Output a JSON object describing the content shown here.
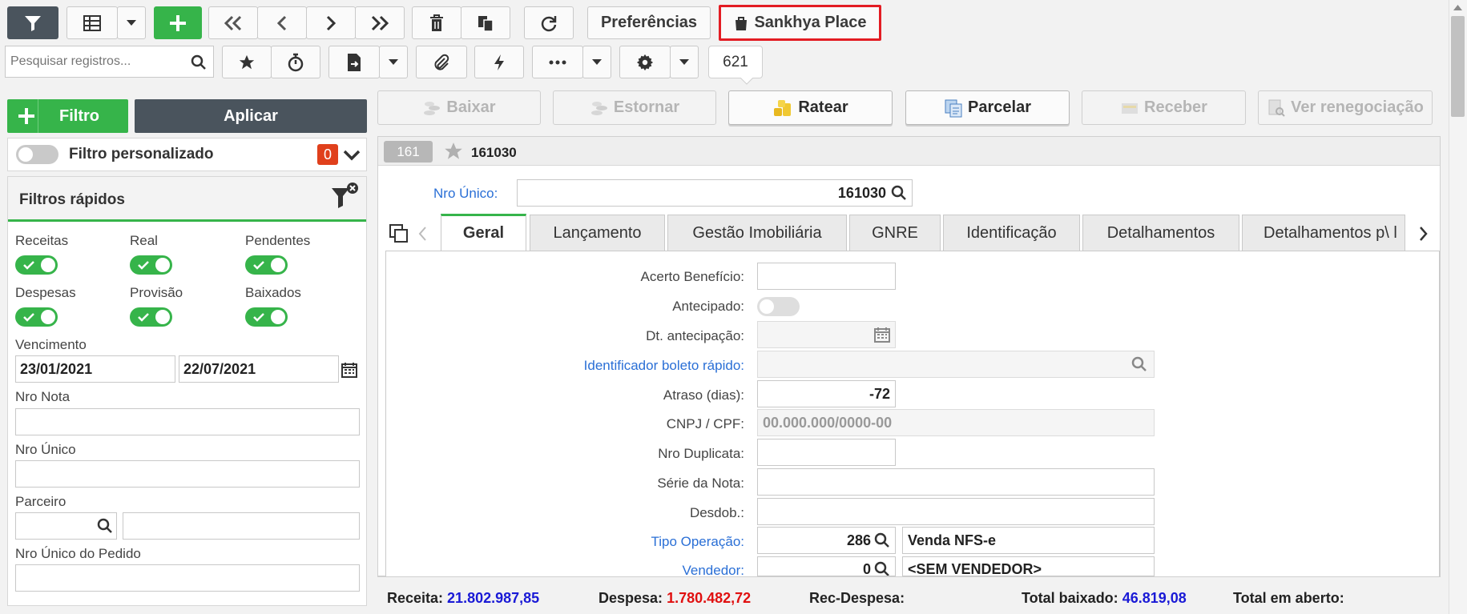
{
  "toolbar": {
    "preferences_label": "Preferências",
    "sankhya_place_label": "Sankhya Place",
    "search_placeholder": "Pesquisar registros...",
    "counter": "621"
  },
  "actions": {
    "baixar": "Baixar",
    "estornar": "Estornar",
    "ratear": "Ratear",
    "parcelar": "Parcelar",
    "receber": "Receber",
    "ver_renegociacao": "Ver renegociação"
  },
  "left": {
    "filter_btn": "Filtro",
    "apply_btn": "Aplicar",
    "custom_filter_label": "Filtro personalizado",
    "custom_filter_count": "0",
    "quick_filters_title": "Filtros rápidos",
    "toggles": [
      {
        "label": "Receitas"
      },
      {
        "label": "Real"
      },
      {
        "label": "Pendentes"
      },
      {
        "label": "Despesas"
      },
      {
        "label": "Provisão"
      },
      {
        "label": "Baixados"
      }
    ],
    "vencimento_label": "Vencimento",
    "date_from": "23/01/2021",
    "date_to": "22/07/2021",
    "nro_nota_label": "Nro Nota",
    "nro_unico_label": "Nro Único",
    "parceiro_label": "Parceiro",
    "nro_unico_pedido_label": "Nro Único do Pedido"
  },
  "record": {
    "badge": "161",
    "id": "161030",
    "nro_unico_label": "Nro Único:",
    "nro_unico_value": "161030"
  },
  "tabs": [
    "Geral",
    "Lançamento",
    "Gestão Imobiliária",
    "GNRE",
    "Identificação",
    "Detalhamentos",
    "Detalhamentos p\\ l"
  ],
  "form": {
    "acerto_beneficio": "Acerto Benefício:",
    "antecipado": "Antecipado:",
    "dt_antecipacao": "Dt. antecipação:",
    "identificador_boleto": "Identificador boleto rápido:",
    "atraso": "Atraso (dias):",
    "atraso_value": "-72",
    "cnpj_cpf": "CNPJ / CPF:",
    "cnpj_placeholder": "00.000.000/0000-00",
    "nro_duplicata": "Nro Duplicata:",
    "serie_nota": "Série da Nota:",
    "desdob": "Desdob.:",
    "tipo_operacao": "Tipo Operação:",
    "tipo_operacao_code": "286",
    "tipo_operacao_desc": "Venda NFS-e",
    "vendedor": "Vendedor:",
    "vendedor_code": "0",
    "vendedor_desc": "<SEM VENDEDOR>"
  },
  "footer": {
    "receita_label": "Receita:",
    "receita_value": "21.802.987,85",
    "despesa_label": "Despesa:",
    "despesa_value": "1.780.482,72",
    "rec_despesa_label": "Rec-Despesa:",
    "total_baixado_label": "Total baixado:",
    "total_baixado_value": "46.819,08",
    "total_aberto_label": "Total em aberto:"
  },
  "colors": {
    "green": "#36b44a",
    "dark": "#4a545d",
    "link": "#2a6fd6",
    "highlight": "#e31c23",
    "receita": "#1a1ad6",
    "despesa": "#e01010"
  }
}
